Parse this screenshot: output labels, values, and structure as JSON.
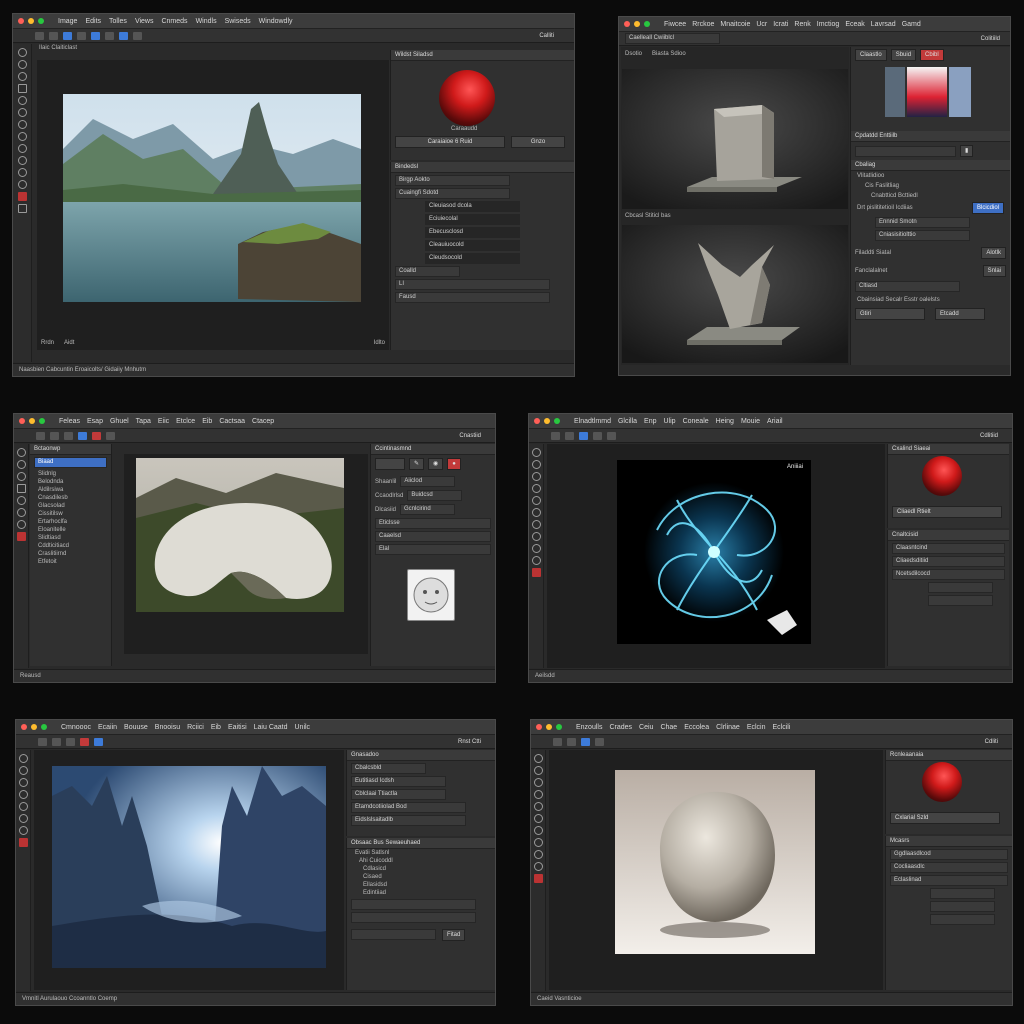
{
  "windows": [
    {
      "menu": [
        "Image",
        "Edits",
        "Tolles",
        "Views",
        "Cnmeds",
        "Windls",
        "Swiseds",
        "Windowdly"
      ],
      "tab_label": "Calliti",
      "options_label": "Ilaic Claiticlast",
      "panel_title": "Wildst Siladsd",
      "sphere_caption": "Caraaudd",
      "bar_label": "Caraiaioe 6 Ruid",
      "bar_button": "Gnzo",
      "sub_title": "Bindedsl",
      "fields": [
        "Birgp Aokto",
        "Cuaingfi Sdotd",
        "Coalld"
      ],
      "list": [
        "Cleuiasod dcola",
        "Eciuiecolal",
        "Ebecusclosd",
        "Cleauiuocold",
        "Cleudsocold"
      ],
      "panel_footer": [
        "LI",
        "Fausd"
      ],
      "canvas_footer": [
        "Rrdn",
        "Aidt",
        "Idlto"
      ],
      "status": "Naasbien Cabcuntin Eroaicolts/ Gidaiiy Mnhutm"
    },
    {
      "menu": [
        "Fiwcee",
        "Rrckoe",
        "Mnaitcoie",
        "Ucr",
        "Icrati",
        "Renk",
        "Imctiog",
        "Eceak",
        "Lavrsad",
        "Gamd"
      ],
      "address": "Caelleall Cwiiblcl",
      "tab_label": "Colitiild",
      "viewport_top_labels": [
        "Dsotio",
        "Biasta Sdioo"
      ],
      "viewport_mid_label": "Cbcasl Stiticl bas",
      "right_tabs": [
        "Claastlo",
        "Sbuid",
        "Cbibl"
      ],
      "panel_title": "Cpdatdd Enttiilb",
      "section": "Cbaliag",
      "tree": [
        "Vlitatlidioo",
        "Cis Faslitliag",
        "Cnabtticd Bcttiedl",
        "Drt pislititetioil Icdiias"
      ],
      "tree_selected": "Blcicdiol",
      "rows": [
        "Ennnid Smotn",
        "Cniasisitiolttio"
      ],
      "labels": [
        "Filaddti Siatal",
        "Fanclalalnet"
      ],
      "buttons": [
        "Alotlk",
        "Snlai"
      ],
      "footer_checkbox": "Cltiasd",
      "footer_label": "Cbainsiad Secalr Esstr oalelsts",
      "footer_buttons": [
        "Gtiri",
        "Etcadd"
      ]
    },
    {
      "menu": [
        "Feleas",
        "Esap",
        "Ghuel",
        "Tapa",
        "Eiic",
        "Etclce",
        "Eib",
        "Cactsaa",
        "Ctacep"
      ],
      "tab_label": "Cnastiid",
      "sidebar_title": "Bctaonwp",
      "layers": [
        "Biaad",
        "Slidnlg",
        "Belodnda",
        "Aldilrsiwa",
        "Cnasdilesb",
        "Glacsolad",
        "Cissitilsw",
        "Ertarhoclfa",
        "Eloanitelle",
        "Slidtiasd",
        "Cddticitiacd",
        "Craslitiirnd",
        "Etfetoit"
      ],
      "panel_title": "Ccintinasmnd",
      "properties": [
        "Shaanlil",
        "Ccaodlrlsd",
        "Dlcasiid",
        "Eticlsse",
        "Caaelsd",
        "Elal"
      ],
      "values": [
        "Aiiclod",
        "Buidcsd",
        "Gcnlcirind"
      ],
      "status": "Reausd"
    },
    {
      "menu": [
        "Elnadtlmmd",
        "Glcilla",
        "Enp",
        "Ulip",
        "Coneale",
        "Heing",
        "Mouie",
        "Ariail"
      ],
      "tab_label": "Cdlitiid",
      "canvas_badge": "Aniiiai",
      "panel_title": "Cxalind Siaeai",
      "bar_label": "Cliaedl Rtielt",
      "sub_title": "Cnaltcisid",
      "rows": [
        "Claasntcind",
        "Cliaedsditiid",
        "Ncetsdilcocd"
      ],
      "status": "Aeilsdd"
    },
    {
      "menu": [
        "Cmnoooc",
        "Ecaiin",
        "Bouuse",
        "Bnooisu",
        "Rciici",
        "Eib",
        "Eaitisi",
        "Laiu Caatd",
        "Unilc"
      ],
      "tab_label": "Rnst Ctti",
      "panel_title": "Gnasadoo",
      "rows": [
        "Cbalcsbld",
        "Eutitiasd Icdsh",
        "Cblclaai Ttiactla",
        "Etamdcotiiolad Bod",
        "Eidslslsaitadlb"
      ],
      "panel2_title": "Obsaac Bus Sewaeuhaed",
      "rows2": [
        "Evatii Satlsnl",
        "Ahi Cuicoddl",
        "Cdlasicd",
        "Cisaed",
        "Ellasidsd",
        "Edintiiad"
      ],
      "footer_button": "Fitad",
      "status": "Vmnitl Aurulaouo Ccoanntlo Coemp"
    },
    {
      "menu": [
        "Enzoulls",
        "Crades",
        "Ceiu",
        "Chae",
        "Eccolea",
        "Clrlinae",
        "Eclcin",
        "Eclcili"
      ],
      "tab_label": "Cdliti",
      "panel_title": "Rcnleaanaia",
      "bar_label": "Cxlarial Szld",
      "sub_title": "Mcasrs",
      "rows": [
        "Ggdlaasdlcod",
        "Cocliaasdlc",
        "Eclaslinad"
      ],
      "status": "Caeid Vasnticioe"
    }
  ]
}
